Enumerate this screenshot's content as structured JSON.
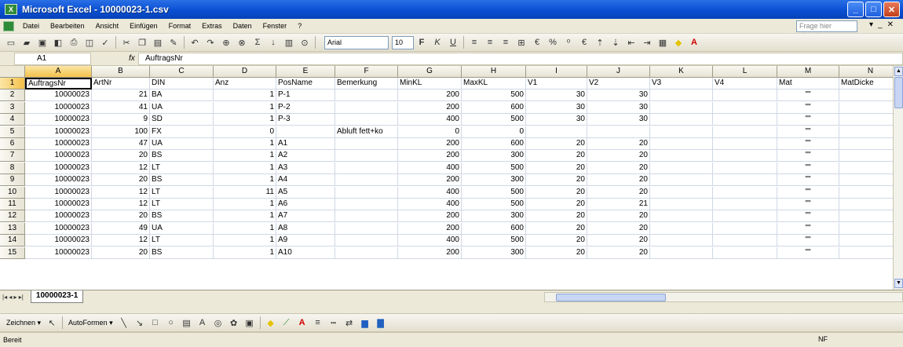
{
  "window": {
    "title": "Microsoft Excel - 10000023-1.csv"
  },
  "menu": {
    "items": [
      "Datei",
      "Bearbeiten",
      "Ansicht",
      "Einfügen",
      "Format",
      "Extras",
      "Daten",
      "Fenster",
      "?"
    ],
    "help_placeholder": "Frage hier eingeben"
  },
  "toolbar": {
    "font_name": "Arial",
    "font_size": "10"
  },
  "formula_bar": {
    "cell_ref": "A1",
    "fx": "fx",
    "value": "AuftragsNr"
  },
  "sheet": {
    "columns": [
      "A",
      "B",
      "C",
      "D",
      "E",
      "F",
      "G",
      "H",
      "I",
      "J",
      "K",
      "L",
      "M",
      "N"
    ],
    "rows": [
      [
        "AuftragsNr",
        "ArtNr",
        "DIN",
        "Anz",
        "PosName",
        "Bemerkung",
        "MinKL",
        "MaxKL",
        "V1",
        "V2",
        "V3",
        "V4",
        "Mat",
        "MatDicke"
      ],
      [
        "10000023",
        "21",
        "BA",
        "1",
        "P-1",
        "",
        "200",
        "500",
        "30",
        "30",
        "",
        "",
        "\"\"",
        ""
      ],
      [
        "10000023",
        "41",
        "UA",
        "1",
        "P-2",
        "",
        "200",
        "600",
        "30",
        "30",
        "",
        "",
        "\"\"",
        ""
      ],
      [
        "10000023",
        "9",
        "SD",
        "1",
        "P-3",
        "",
        "400",
        "500",
        "30",
        "30",
        "",
        "",
        "\"\"",
        ""
      ],
      [
        "10000023",
        "100",
        "FX",
        "0",
        "",
        "Abluft fett+ko",
        "0",
        "0",
        "",
        "",
        "",
        "",
        "\"\"",
        ""
      ],
      [
        "10000023",
        "47",
        "UA",
        "1",
        "A1",
        "",
        "200",
        "600",
        "20",
        "20",
        "",
        "",
        "\"\"",
        ""
      ],
      [
        "10000023",
        "20",
        "BS",
        "1",
        "A2",
        "",
        "200",
        "300",
        "20",
        "20",
        "",
        "",
        "\"\"",
        ""
      ],
      [
        "10000023",
        "12",
        "LT",
        "1",
        "A3",
        "",
        "400",
        "500",
        "20",
        "20",
        "",
        "",
        "\"\"",
        ""
      ],
      [
        "10000023",
        "20",
        "BS",
        "1",
        "A4",
        "",
        "200",
        "300",
        "20",
        "20",
        "",
        "",
        "\"\"",
        ""
      ],
      [
        "10000023",
        "12",
        "LT",
        "11",
        "A5",
        "",
        "400",
        "500",
        "20",
        "20",
        "",
        "",
        "\"\"",
        ""
      ],
      [
        "10000023",
        "12",
        "LT",
        "1",
        "A6",
        "",
        "400",
        "500",
        "20",
        "21",
        "",
        "",
        "\"\"",
        ""
      ],
      [
        "10000023",
        "20",
        "BS",
        "1",
        "A7",
        "",
        "200",
        "300",
        "20",
        "20",
        "",
        "",
        "\"\"",
        ""
      ],
      [
        "10000023",
        "49",
        "UA",
        "1",
        "A8",
        "",
        "200",
        "600",
        "20",
        "20",
        "",
        "",
        "\"\"",
        ""
      ],
      [
        "10000023",
        "12",
        "LT",
        "1",
        "A9",
        "",
        "400",
        "500",
        "20",
        "20",
        "",
        "",
        "\"\"",
        ""
      ],
      [
        "10000023",
        "20",
        "BS",
        "1",
        "A10",
        "",
        "200",
        "300",
        "20",
        "20",
        "",
        "",
        "\"\"",
        ""
      ]
    ]
  },
  "tabs": {
    "nav": "|◂ ◂ ▸ ▸|",
    "active": "10000023-1"
  },
  "drawing": {
    "zeichnen": "Zeichnen ▾",
    "autoformen": "AutoFormen ▾"
  },
  "status": {
    "left": "Bereit",
    "right": "NF"
  }
}
